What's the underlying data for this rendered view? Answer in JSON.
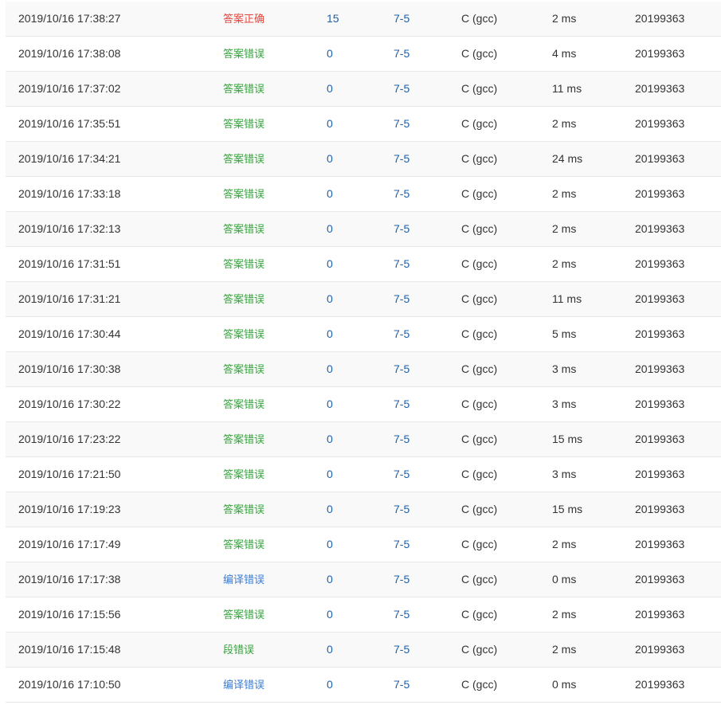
{
  "colors": {
    "accepted": "#e2463b",
    "wrong": "#34a33b",
    "compile_error": "#3a7dd8",
    "link": "#1f5fa8"
  },
  "submissions": [
    {
      "time": "2019/10/16 17:38:27",
      "status": "答案正确",
      "status_color": "red",
      "score": "15",
      "problem": "7-5",
      "language": "C (gcc)",
      "runtime": "2 ms",
      "user": "20199363"
    },
    {
      "time": "2019/10/16 17:38:08",
      "status": "答案错误",
      "status_color": "green",
      "score": "0",
      "problem": "7-5",
      "language": "C (gcc)",
      "runtime": "4 ms",
      "user": "20199363"
    },
    {
      "time": "2019/10/16 17:37:02",
      "status": "答案错误",
      "status_color": "green",
      "score": "0",
      "problem": "7-5",
      "language": "C (gcc)",
      "runtime": "11 ms",
      "user": "20199363"
    },
    {
      "time": "2019/10/16 17:35:51",
      "status": "答案错误",
      "status_color": "green",
      "score": "0",
      "problem": "7-5",
      "language": "C (gcc)",
      "runtime": "2 ms",
      "user": "20199363"
    },
    {
      "time": "2019/10/16 17:34:21",
      "status": "答案错误",
      "status_color": "green",
      "score": "0",
      "problem": "7-5",
      "language": "C (gcc)",
      "runtime": "24 ms",
      "user": "20199363"
    },
    {
      "time": "2019/10/16 17:33:18",
      "status": "答案错误",
      "status_color": "green",
      "score": "0",
      "problem": "7-5",
      "language": "C (gcc)",
      "runtime": "2 ms",
      "user": "20199363"
    },
    {
      "time": "2019/10/16 17:32:13",
      "status": "答案错误",
      "status_color": "green",
      "score": "0",
      "problem": "7-5",
      "language": "C (gcc)",
      "runtime": "2 ms",
      "user": "20199363"
    },
    {
      "time": "2019/10/16 17:31:51",
      "status": "答案错误",
      "status_color": "green",
      "score": "0",
      "problem": "7-5",
      "language": "C (gcc)",
      "runtime": "2 ms",
      "user": "20199363"
    },
    {
      "time": "2019/10/16 17:31:21",
      "status": "答案错误",
      "status_color": "green",
      "score": "0",
      "problem": "7-5",
      "language": "C (gcc)",
      "runtime": "11 ms",
      "user": "20199363"
    },
    {
      "time": "2019/10/16 17:30:44",
      "status": "答案错误",
      "status_color": "green",
      "score": "0",
      "problem": "7-5",
      "language": "C (gcc)",
      "runtime": "5 ms",
      "user": "20199363"
    },
    {
      "time": "2019/10/16 17:30:38",
      "status": "答案错误",
      "status_color": "green",
      "score": "0",
      "problem": "7-5",
      "language": "C (gcc)",
      "runtime": "3 ms",
      "user": "20199363"
    },
    {
      "time": "2019/10/16 17:30:22",
      "status": "答案错误",
      "status_color": "green",
      "score": "0",
      "problem": "7-5",
      "language": "C (gcc)",
      "runtime": "3 ms",
      "user": "20199363"
    },
    {
      "time": "2019/10/16 17:23:22",
      "status": "答案错误",
      "status_color": "green",
      "score": "0",
      "problem": "7-5",
      "language": "C (gcc)",
      "runtime": "15 ms",
      "user": "20199363"
    },
    {
      "time": "2019/10/16 17:21:50",
      "status": "答案错误",
      "status_color": "green",
      "score": "0",
      "problem": "7-5",
      "language": "C (gcc)",
      "runtime": "3 ms",
      "user": "20199363"
    },
    {
      "time": "2019/10/16 17:19:23",
      "status": "答案错误",
      "status_color": "green",
      "score": "0",
      "problem": "7-5",
      "language": "C (gcc)",
      "runtime": "15 ms",
      "user": "20199363"
    },
    {
      "time": "2019/10/16 17:17:49",
      "status": "答案错误",
      "status_color": "green",
      "score": "0",
      "problem": "7-5",
      "language": "C (gcc)",
      "runtime": "2 ms",
      "user": "20199363"
    },
    {
      "time": "2019/10/16 17:17:38",
      "status": "编译错误",
      "status_color": "blue",
      "score": "0",
      "problem": "7-5",
      "language": "C (gcc)",
      "runtime": "0 ms",
      "user": "20199363"
    },
    {
      "time": "2019/10/16 17:15:56",
      "status": "答案错误",
      "status_color": "green",
      "score": "0",
      "problem": "7-5",
      "language": "C (gcc)",
      "runtime": "2 ms",
      "user": "20199363"
    },
    {
      "time": "2019/10/16 17:15:48",
      "status": "段错误",
      "status_color": "green",
      "score": "0",
      "problem": "7-5",
      "language": "C (gcc)",
      "runtime": "2 ms",
      "user": "20199363"
    },
    {
      "time": "2019/10/16 17:10:50",
      "status": "编译错误",
      "status_color": "blue",
      "score": "0",
      "problem": "7-5",
      "language": "C (gcc)",
      "runtime": "0 ms",
      "user": "20199363"
    }
  ]
}
